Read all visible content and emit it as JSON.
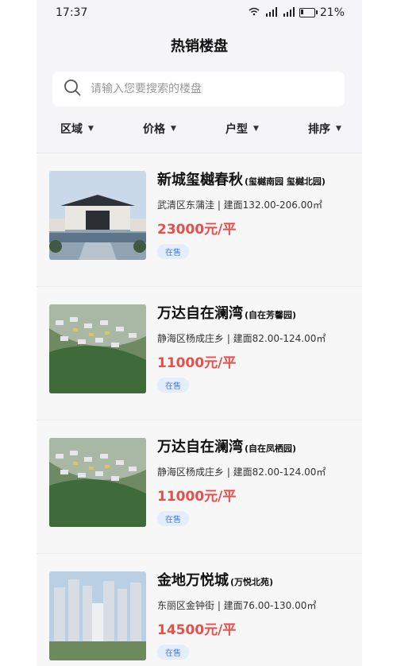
{
  "status": {
    "time": "17:37",
    "net1": "4G",
    "net2": "4G",
    "battery": "21%",
    "battery_level": 0.21
  },
  "page": {
    "title": "热销楼盘"
  },
  "search": {
    "placeholder": "请输入您要搜索的楼盘"
  },
  "filters": [
    "区域",
    "价格",
    "户型",
    "排序"
  ],
  "listings": [
    {
      "name": "新城玺樾春秋",
      "sub": "(玺樾南园 玺樾北园)",
      "address": "武清区东蒲洼 | 建面132.00-206.00㎡",
      "price": "23000元/平",
      "status": "在售",
      "image": "courtyard-gate"
    },
    {
      "name": "万达自在澜湾",
      "sub": "(自在芳馨园)",
      "address": "静海区杨成庄乡 | 建面82.00-124.00㎡",
      "price": "11000元/平",
      "status": "在售",
      "image": "aerial-complex"
    },
    {
      "name": "万达自在澜湾",
      "sub": "(自在凤栖园)",
      "address": "静海区杨成庄乡 | 建面82.00-124.00㎡",
      "price": "11000元/平",
      "status": "在售",
      "image": "aerial-complex"
    },
    {
      "name": "金地万悦城",
      "sub": "(万悦北苑)",
      "address": "东丽区金钟街 | 建面76.00-130.00㎡",
      "price": "14500元/平",
      "status": "在售",
      "image": "highrise-towers"
    }
  ],
  "colors": {
    "price": "#e84f4a",
    "badge_text": "#4a7fd8",
    "badge_bg": "#e3edfb",
    "background": "#f5f5f7"
  }
}
